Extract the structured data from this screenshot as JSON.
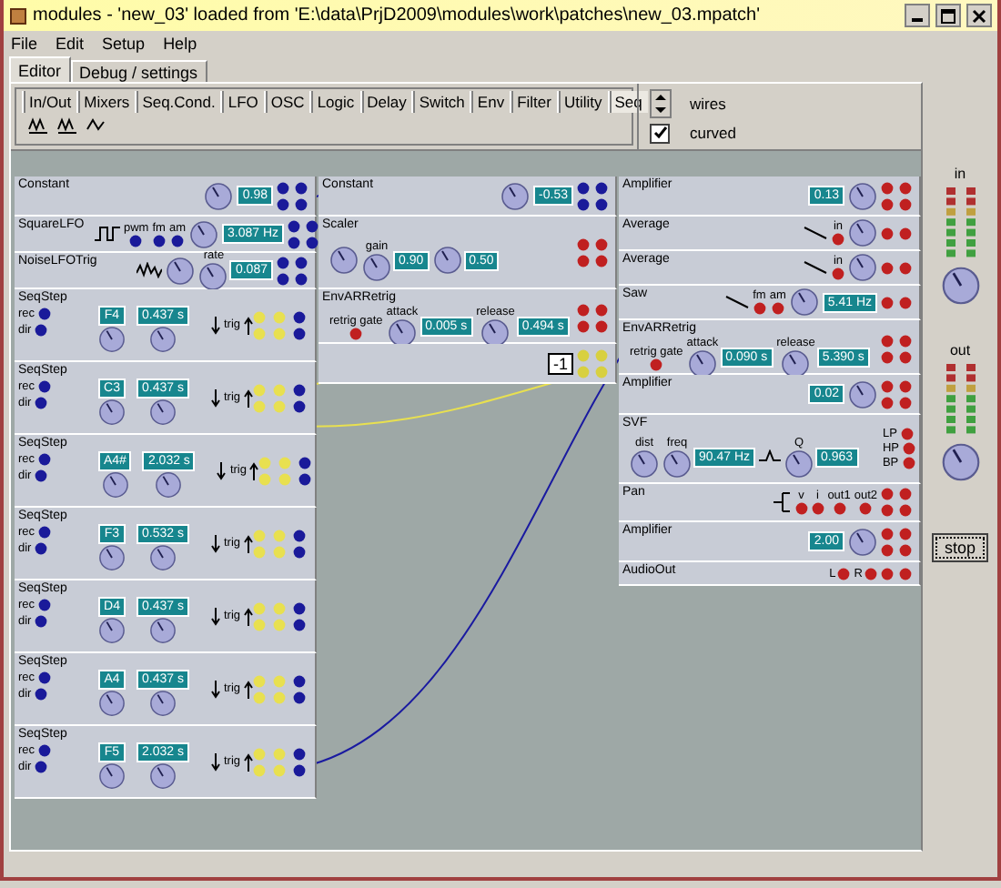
{
  "window": {
    "title": "modules - 'new_03' loaded from 'E:\\data\\PrjD2009\\modules\\work\\patches\\new_03.mpatch'"
  },
  "menu": [
    "File",
    "Edit",
    "Setup",
    "Help"
  ],
  "tabs": [
    {
      "label": "Editor",
      "selected": true
    },
    {
      "label": "Debug / settings",
      "selected": false
    }
  ],
  "categories": [
    {
      "label": "In/Out",
      "selected": false
    },
    {
      "label": "Mixers",
      "selected": false
    },
    {
      "label": "Seq.Cond.",
      "selected": false
    },
    {
      "label": "LFO",
      "selected": false
    },
    {
      "label": "OSC",
      "selected": false
    },
    {
      "label": "Logic",
      "selected": false
    },
    {
      "label": "Delay",
      "selected": false
    },
    {
      "label": "Switch",
      "selected": false
    },
    {
      "label": "Env",
      "selected": false
    },
    {
      "label": "Filter",
      "selected": false
    },
    {
      "label": "Utility",
      "selected": false
    },
    {
      "label": "Seq",
      "selected": true
    }
  ],
  "wire_options": {
    "wires_label": "wires",
    "curved_label": "curved",
    "curved": true
  },
  "columns": [
    [
      {
        "kind": "constant",
        "title": "Constant",
        "color": "#1a1a9a",
        "controls": [
          {
            "kind": "knob"
          },
          {
            "kind": "display",
            "value": "0.98"
          }
        ]
      },
      {
        "kind": "lfo",
        "title": "SquareLFO",
        "color": "#1a1a9a",
        "controls": [
          {
            "kind": "square_wave"
          },
          {
            "kind": "input",
            "label": "pwm"
          },
          {
            "kind": "input",
            "label": "fm"
          },
          {
            "kind": "input",
            "label": "am"
          },
          {
            "kind": "knob"
          },
          {
            "kind": "display",
            "value": "3.087 Hz"
          }
        ]
      },
      {
        "kind": "lfo",
        "title": "NoiseLFOTrig",
        "color": "#1a1a9a",
        "controls": [
          {
            "kind": "noise_wave"
          },
          {
            "kind": "knob"
          },
          {
            "kind": "knob",
            "label": "rate",
            "value": "0.087"
          }
        ]
      },
      {
        "kind": "seqstep",
        "title": "SeqStep",
        "color": "#1a1a9a",
        "note": "F4",
        "time": "0.437 s",
        "inputs": [
          "rec",
          "dir"
        ],
        "trig": "trig"
      },
      {
        "kind": "seqstep",
        "title": "SeqStep",
        "color": "#1a1a9a",
        "note": "C3",
        "time": "0.437 s",
        "inputs": [
          "rec",
          "dir"
        ],
        "trig": "trig"
      },
      {
        "kind": "seqstep",
        "title": "SeqStep",
        "color": "#1a1a9a",
        "note": "A4#",
        "time": "2.032 s",
        "inputs": [
          "rec",
          "dir"
        ],
        "trig": "trig"
      },
      {
        "kind": "seqstep",
        "title": "SeqStep",
        "color": "#1a1a9a",
        "note": "F3",
        "time": "0.532 s",
        "inputs": [
          "rec",
          "dir"
        ],
        "trig": "trig"
      },
      {
        "kind": "seqstep",
        "title": "SeqStep",
        "color": "#1a1a9a",
        "note": "D4",
        "time": "0.437 s",
        "inputs": [
          "rec",
          "dir"
        ],
        "trig": "trig"
      },
      {
        "kind": "seqstep",
        "title": "SeqStep",
        "color": "#1a1a9a",
        "note": "A4",
        "time": "0.437 s",
        "inputs": [
          "rec",
          "dir"
        ],
        "trig": "trig"
      },
      {
        "kind": "seqstep",
        "title": "SeqStep",
        "color": "#1a1a9a",
        "note": "F5",
        "time": "2.032 s",
        "inputs": [
          "rec",
          "dir"
        ],
        "trig": "trig"
      }
    ],
    [
      {
        "kind": "constant",
        "title": "Constant",
        "color": "#1a1a9a",
        "controls": [
          {
            "kind": "knob"
          },
          {
            "kind": "display",
            "value": "-0.53"
          }
        ]
      },
      {
        "kind": "scaler",
        "title": "Scaler",
        "color": "#c02020",
        "controls": [
          {
            "kind": "knob"
          },
          {
            "kind": "knob",
            "label": "gain",
            "value": "0.90"
          },
          {
            "kind": "knob",
            "value": "0.50"
          }
        ]
      },
      {
        "kind": "env",
        "title": "EnvARRetrig",
        "color": "#c02020",
        "controls": [
          {
            "kind": "input",
            "label": "retrig gate"
          },
          {
            "kind": "knob",
            "label": "attack",
            "value": "0.005 s"
          },
          {
            "kind": "knob",
            "label": "release",
            "value": "0.494 s"
          }
        ]
      },
      {
        "kind": "invert",
        "color": "#d8d040",
        "controls": [
          {
            "kind": "symbol",
            "value": "-1"
          }
        ]
      }
    ],
    [
      {
        "kind": "amplifier",
        "title": "Amplifier",
        "color": "#c02020",
        "controls": [
          {
            "kind": "display",
            "value": "0.13"
          },
          {
            "kind": "knob"
          }
        ]
      },
      {
        "kind": "average",
        "title": "Average",
        "color": "#c02020",
        "controls": [
          {
            "kind": "slope"
          },
          {
            "kind": "input",
            "label": "in"
          },
          {
            "kind": "knob"
          }
        ]
      },
      {
        "kind": "average",
        "title": "Average",
        "color": "#c02020",
        "controls": [
          {
            "kind": "slope"
          },
          {
            "kind": "input",
            "label": "in"
          },
          {
            "kind": "knob"
          }
        ]
      },
      {
        "kind": "average",
        "title": "Saw",
        "color": "#c02020",
        "controls": [
          {
            "kind": "slope"
          },
          {
            "kind": "input",
            "label": "fm"
          },
          {
            "kind": "input",
            "label": "am"
          },
          {
            "kind": "knob"
          },
          {
            "kind": "display",
            "value": "5.41 Hz"
          }
        ]
      },
      {
        "kind": "env",
        "title": "EnvARRetrig",
        "color": "#c02020",
        "controls": [
          {
            "kind": "input",
            "label": "retrig gate"
          },
          {
            "kind": "knob",
            "label": "attack",
            "value": "0.090 s"
          },
          {
            "kind": "knob",
            "label": "release",
            "value": "5.390 s"
          }
        ]
      },
      {
        "kind": "amplifier",
        "title": "Amplifier",
        "color": "#c02020",
        "controls": [
          {
            "kind": "display",
            "value": "0.02"
          },
          {
            "kind": "knob"
          }
        ]
      },
      {
        "kind": "filter",
        "title": "SVF",
        "color": "#c02020",
        "controls": [
          {
            "kind": "knob",
            "label": "dist"
          },
          {
            "kind": "knob",
            "label": "freq",
            "value": "90.47 Hz"
          },
          {
            "kind": "peak"
          },
          {
            "kind": "knob",
            "label": "Q",
            "value": "0.963"
          }
        ],
        "outputs": [
          "LP",
          "HP",
          "BP"
        ]
      },
      {
        "kind": "pan",
        "title": "Pan",
        "color": "#c02020",
        "controls": [
          {
            "kind": "bracket"
          },
          {
            "kind": "input",
            "label": "v"
          },
          {
            "kind": "input",
            "label": "i"
          },
          {
            "kind": "input",
            "label": "out1"
          },
          {
            "kind": "input",
            "label": "out2"
          }
        ]
      },
      {
        "kind": "amplifier",
        "title": "Amplifier",
        "color": "#c02020",
        "controls": [
          {
            "kind": "display",
            "value": "2.00"
          },
          {
            "kind": "knob"
          }
        ]
      },
      {
        "kind": "out",
        "title": "AudioOut",
        "color": "#c02020",
        "controls": [
          {
            "kind": "input",
            "label": "L"
          },
          {
            "kind": "input",
            "label": "R"
          }
        ]
      }
    ]
  ],
  "meters": [
    {
      "label": "in"
    },
    {
      "label": "out"
    }
  ],
  "stop_button": "stop"
}
